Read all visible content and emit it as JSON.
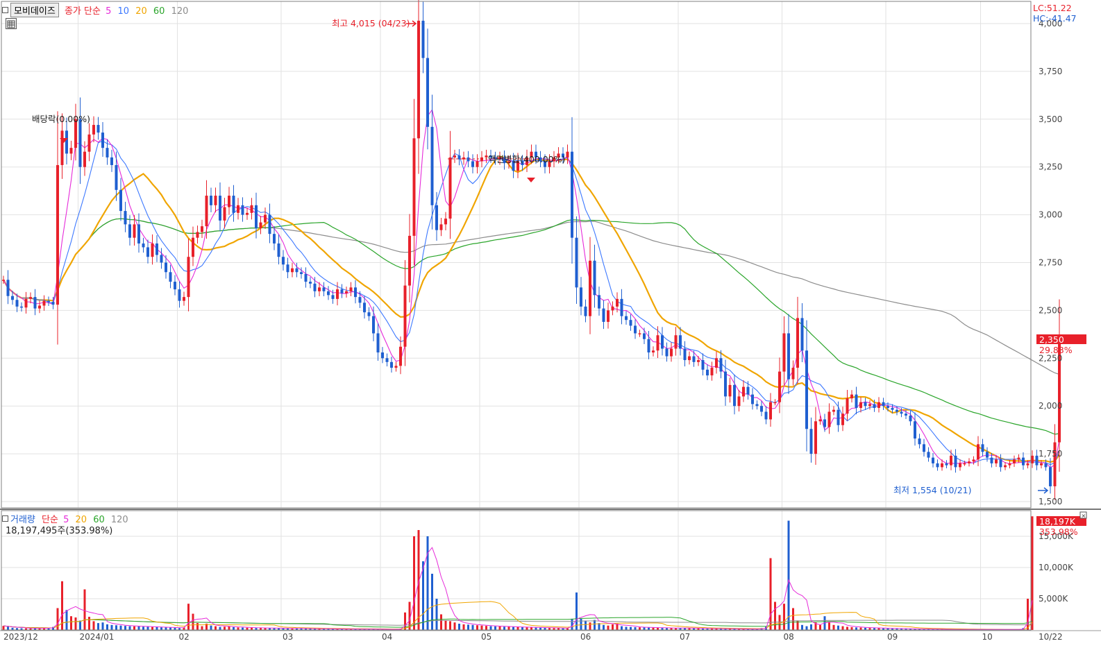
{
  "price_panel": {
    "stock_name": "모비데이즈",
    "indicator_label": "종가 단순",
    "ma_periods": [
      "5",
      "10",
      "20",
      "60",
      "120"
    ],
    "lc_text": "LC:51.22",
    "hc_text": "HC:-41.47",
    "high_annotation": "최고 4,015 (04/23)",
    "low_annotation": "최저 1,554 (10/21)",
    "dividend_annotation": "배당락(0.00%)",
    "split_annotation": "액면병합(400.00%)",
    "current_price_tag": "2,350",
    "current_change_tag": "29.83%"
  },
  "volume_panel": {
    "title": "거래량",
    "indicator_label": "단순",
    "ma_periods": [
      "5",
      "20",
      "60",
      "120"
    ],
    "current_volume_text": "18,197,495주(353.98%)",
    "current_volume_tag": "18,197K",
    "current_volume_pct_tag": "353.98%"
  },
  "colors": {
    "up": "#e8202a",
    "down": "#1f5fd0",
    "ma5": "#e62ad9",
    "ma10": "#3c78ff",
    "ma20": "#f0a500",
    "ma60": "#2aa52a",
    "ma120": "#8c8c8c"
  },
  "chart_data": {
    "type": "candlestick",
    "price_axis": {
      "ticks": [
        "1,500",
        "1,750",
        "2,000",
        "2,250",
        "2,500",
        "2,750",
        "3,000",
        "3,250",
        "3,500",
        "3,750",
        "4,000"
      ],
      "min": 1500,
      "max": 4000
    },
    "volume_axis": {
      "ticks": [
        "5,000K",
        "10,000K",
        "15,000K"
      ],
      "min": 0,
      "max": 18000
    },
    "date_labels": [
      "2023/12",
      "2024/01",
      "02",
      "03",
      "04",
      "05",
      "06",
      "07",
      "08",
      "09",
      "10",
      "10/22"
    ],
    "month_start_index": [
      0,
      17,
      39,
      62,
      84,
      106,
      128,
      150,
      173,
      196,
      217
    ],
    "volume_ma_period": 5,
    "close": [
      2660,
      2575,
      2555,
      2520,
      2515,
      2560,
      2570,
      2510,
      2525,
      2550,
      2545,
      2530,
      3260,
      3440,
      3320,
      3350,
      3500,
      3250,
      3330,
      3420,
      3470,
      3430,
      3350,
      3300,
      3260,
      3130,
      3020,
      2950,
      2880,
      2950,
      2850,
      2830,
      2780,
      2850,
      2790,
      2750,
      2700,
      2650,
      2610,
      2550,
      2570,
      2780,
      2880,
      2910,
      2940,
      3100,
      3050,
      3100,
      2970,
      3040,
      3100,
      3010,
      3050,
      3000,
      3010,
      3050,
      2930,
      2960,
      3000,
      2900,
      2850,
      2780,
      2740,
      2700,
      2720,
      2700,
      2690,
      2650,
      2640,
      2600,
      2620,
      2600,
      2580,
      2560,
      2610,
      2590,
      2600,
      2620,
      2570,
      2540,
      2490,
      2470,
      2380,
      2280,
      2250,
      2230,
      2200,
      2210,
      2310,
      2630,
      2890,
      3400,
      4015,
      3820,
      3460,
      3050,
      2920,
      2950,
      2980,
      3300,
      3310,
      3290,
      3300,
      3280,
      3250,
      3280,
      3300,
      3310,
      3300,
      3290,
      3300,
      3270,
      3280,
      3230,
      3280,
      3260,
      3300,
      3330,
      3300,
      3280,
      3250,
      3280,
      3300,
      3320,
      3300,
      3330,
      2880,
      2620,
      2520,
      2470,
      2760,
      2580,
      2510,
      2440,
      2500,
      2520,
      2560,
      2470,
      2450,
      2420,
      2380,
      2380,
      2350,
      2280,
      2290,
      2370,
      2300,
      2260,
      2300,
      2370,
      2300,
      2240,
      2260,
      2230,
      2240,
      2190,
      2160,
      2200,
      2250,
      2180,
      2050,
      2110,
      2000,
      2050,
      2100,
      2060,
      2010,
      2000,
      1970,
      1930,
      2020,
      2020,
      2180,
      2380,
      2140,
      2200,
      2460,
      2290,
      1880,
      1750,
      1920,
      1930,
      1890,
      1970,
      1980,
      1900,
      1960,
      2040,
      2060,
      1990,
      2020,
      2000,
      2010,
      1990,
      2020,
      2000,
      1990,
      1980,
      1970,
      1960,
      1950,
      1920,
      1830,
      1800,
      1760,
      1730,
      1700,
      1680,
      1700,
      1690,
      1740,
      1680,
      1700,
      1700,
      1710,
      1720,
      1800,
      1760,
      1730,
      1700,
      1720,
      1680,
      1690,
      1700,
      1720,
      1730,
      1690,
      1700,
      1740,
      1690,
      1700,
      1680,
      1580,
      1810,
      2350
    ],
    "volume": [
      650,
      500,
      350,
      300,
      270,
      250,
      220,
      300,
      280,
      330,
      260,
      480,
      3500,
      7800,
      3200,
      2200,
      2000,
      1500,
      6500,
      2100,
      1400,
      1100,
      1200,
      900,
      800,
      750,
      700,
      650,
      600,
      580,
      550,
      520,
      500,
      480,
      450,
      420,
      400,
      380,
      350,
      300,
      400,
      4200,
      2600,
      1100,
      600,
      1000,
      700,
      600,
      480,
      520,
      600,
      450,
      400,
      380,
      360,
      340,
      320,
      310,
      300,
      290,
      280,
      270,
      260,
      250,
      240,
      230,
      220,
      210,
      200,
      190,
      180,
      180,
      170,
      160,
      160,
      150,
      160,
      150,
      140,
      130,
      140,
      130,
      120,
      110,
      100,
      100,
      90,
      100,
      200,
      2800,
      4500,
      15000,
      16000,
      11000,
      15000,
      9000,
      5000,
      2500,
      1500,
      1400,
      1200,
      1000,
      900,
      850,
      800,
      750,
      700,
      650,
      600,
      580,
      550,
      520,
      500,
      480,
      460,
      440,
      420,
      400,
      380,
      360,
      340,
      320,
      300,
      280,
      260,
      250,
      1800,
      6000,
      1800,
      1500,
      1200,
      1600,
      1100,
      800,
      700,
      900,
      1000,
      600,
      500,
      480,
      450,
      420,
      400,
      380,
      360,
      340,
      320,
      300,
      280,
      300,
      320,
      300,
      280,
      260,
      240,
      220,
      200,
      210,
      220,
      200,
      190,
      180,
      170,
      160,
      150,
      140,
      130,
      120,
      300,
      500,
      11500,
      4500,
      2400,
      4200,
      17500,
      3500,
      1500,
      800,
      600,
      900,
      1200,
      800,
      2200,
      1200,
      800,
      700,
      600,
      500,
      450,
      400,
      380,
      350,
      320,
      300,
      280,
      260,
      240,
      220,
      200,
      190,
      180,
      170,
      160,
      150,
      140,
      130,
      120,
      110,
      100,
      90,
      80,
      80,
      80,
      80,
      80,
      80,
      80,
      80,
      80,
      80,
      80,
      80,
      80,
      80,
      80,
      80,
      300,
      5000,
      18197
    ]
  }
}
